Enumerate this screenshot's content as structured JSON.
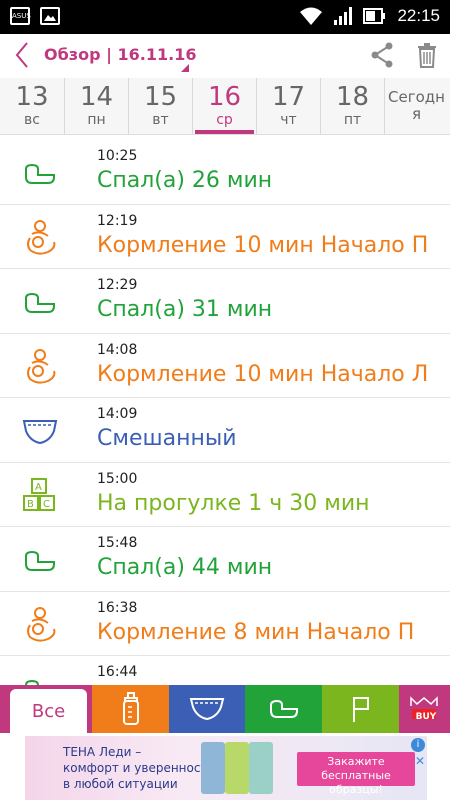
{
  "status_bar": {
    "time": "22:15",
    "asus_label": "ASUS"
  },
  "header": {
    "title": "Обзор | 16.11.16"
  },
  "days": [
    {
      "num": "13",
      "dow": "вс"
    },
    {
      "num": "14",
      "dow": "пн"
    },
    {
      "num": "15",
      "dow": "вт"
    },
    {
      "num": "16",
      "dow": "ср"
    },
    {
      "num": "17",
      "dow": "чт"
    },
    {
      "num": "18",
      "dow": "пт"
    },
    {
      "num": "Сегодн",
      "dow": "я"
    }
  ],
  "active_day": "16",
  "events": [
    {
      "time": "10:25",
      "text": "Спал(а) 26 мин",
      "icon": "crib-icon",
      "color": "#22a33a"
    },
    {
      "time": "12:19",
      "text": "Кормление  10 мин Начало П",
      "icon": "mother-child-icon",
      "color": "#f07d1a"
    },
    {
      "time": "12:29",
      "text": "Спал(а) 31 мин",
      "icon": "crib-icon",
      "color": "#22a33a"
    },
    {
      "time": "14:08",
      "text": "Кормление  10 мин Начало Л",
      "icon": "mother-child-icon",
      "color": "#f07d1a"
    },
    {
      "time": "14:09",
      "text": "Смешанный",
      "icon": "diaper-icon",
      "color": "#3a5fb5"
    },
    {
      "time": "15:00",
      "text": "На прогулке  1 ч 30 мин",
      "icon": "abc-blocks-icon",
      "color": "#7bb61f"
    },
    {
      "time": "15:48",
      "text": "Спал(а) 44 мин",
      "icon": "crib-icon",
      "color": "#22a33a"
    },
    {
      "time": "16:38",
      "text": "Кормление  8 мин Начало П",
      "icon": "mother-child-icon",
      "color": "#f07d1a"
    },
    {
      "time": "16:44",
      "text": "",
      "icon": "crib-icon",
      "color": "#22a33a"
    }
  ],
  "tabs": {
    "all_label": "Все",
    "bottle_color": "#f07d1a",
    "diaper_color": "#3a5fb5",
    "sleep_color": "#22a33a",
    "activity_color": "#7bb61f",
    "buy_label": "BUY",
    "brand_color": "#c0397f"
  },
  "ad": {
    "line1": "ТЕНА Леди –",
    "line2": "комфорт и уверенность",
    "line3": "в любой ситуации",
    "button_line1": "Закажите бесплатные",
    "button_line2": "образцы!"
  }
}
